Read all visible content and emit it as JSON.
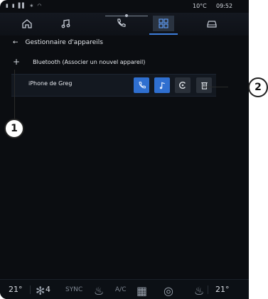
{
  "status": {
    "left": "• • • • •",
    "temp": "10°C",
    "time": "09:52"
  },
  "nav": [
    {
      "name": "home-icon",
      "active": false
    },
    {
      "name": "music-icon",
      "active": false
    },
    {
      "name": "phone-icon",
      "active": false
    },
    {
      "name": "apps-icon",
      "active": true
    },
    {
      "name": "car-icon",
      "active": false
    }
  ],
  "breadcrumb": {
    "back": "←",
    "title": "Gestionnaire d'appareils"
  },
  "bluetooth": {
    "plus": "+",
    "label": "Bluetooth (Associer un nouvel appareil)"
  },
  "device": {
    "name": "iPhone de Greg",
    "actions": [
      {
        "name": "phone-call-icon",
        "color": "blue"
      },
      {
        "name": "music-note-icon",
        "color": "blue"
      },
      {
        "name": "cycle-icon",
        "color": "dark"
      },
      {
        "name": "trash-icon",
        "color": "dark"
      }
    ]
  },
  "callouts": {
    "one": "1",
    "two": "2"
  },
  "climate": {
    "temp_left": "21°",
    "fan": "4",
    "sync": "SYNC",
    "ac": "A/C",
    "temp_right": "21°"
  }
}
